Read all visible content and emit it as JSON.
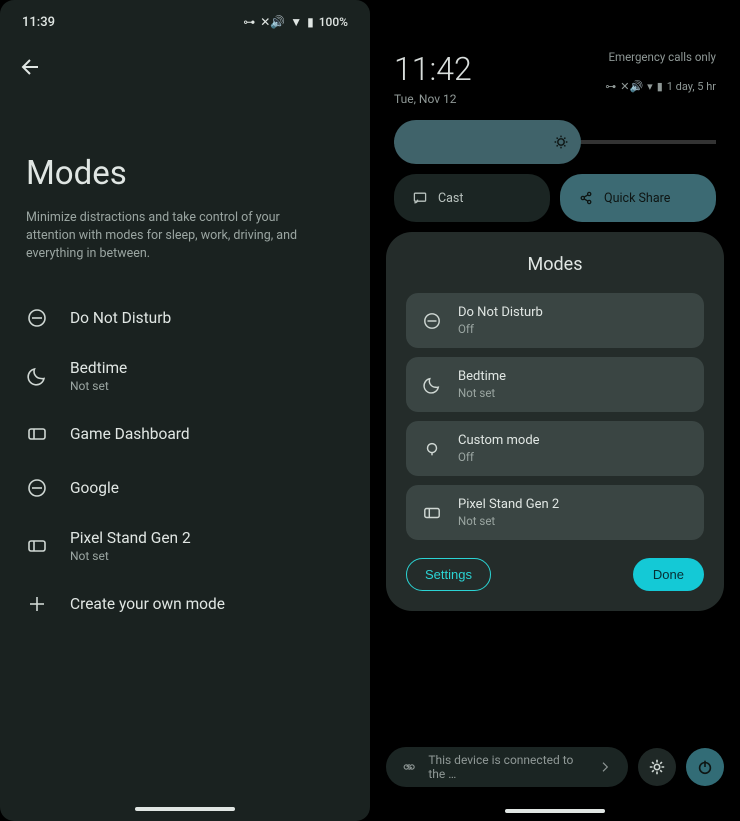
{
  "left": {
    "status": {
      "time": "11:39",
      "battery": "100%",
      "vpn": "⊶",
      "mute": "🔇",
      "wifi": "▾",
      "batt_icon": "▮"
    },
    "title": "Modes",
    "description": "Minimize distractions and take control of your attention with modes for sleep, work, driving, and everything in between.",
    "items": [
      {
        "icon": "dnd",
        "label": "Do Not Disturb",
        "sub": ""
      },
      {
        "icon": "moon",
        "label": "Bedtime",
        "sub": "Not set"
      },
      {
        "icon": "ticket",
        "label": "Game Dashboard",
        "sub": ""
      },
      {
        "icon": "dnd",
        "label": "Google",
        "sub": ""
      },
      {
        "icon": "ticket",
        "label": "Pixel Stand Gen 2",
        "sub": "Not set"
      },
      {
        "icon": "plus",
        "label": "Create your own mode",
        "sub": ""
      }
    ]
  },
  "right": {
    "clock": "11:42",
    "date": "Tue, Nov 12",
    "emergency": "Emergency calls only",
    "battery_status": "1 day, 5 hr",
    "tiles": [
      {
        "icon": "cast",
        "label": "Cast",
        "active": false
      },
      {
        "icon": "share",
        "label": "Quick Share",
        "active": true
      }
    ],
    "modal": {
      "title": "Modes",
      "items": [
        {
          "icon": "dnd",
          "label": "Do Not Disturb",
          "sub": "Off"
        },
        {
          "icon": "moon",
          "label": "Bedtime",
          "sub": "Not set"
        },
        {
          "icon": "bulb",
          "label": "Custom mode",
          "sub": "Off"
        },
        {
          "icon": "ticket",
          "label": "Pixel Stand Gen 2",
          "sub": "Not set"
        }
      ],
      "settings_label": "Settings",
      "done_label": "Done"
    },
    "bottom_pill": "This device is connected to the …"
  }
}
